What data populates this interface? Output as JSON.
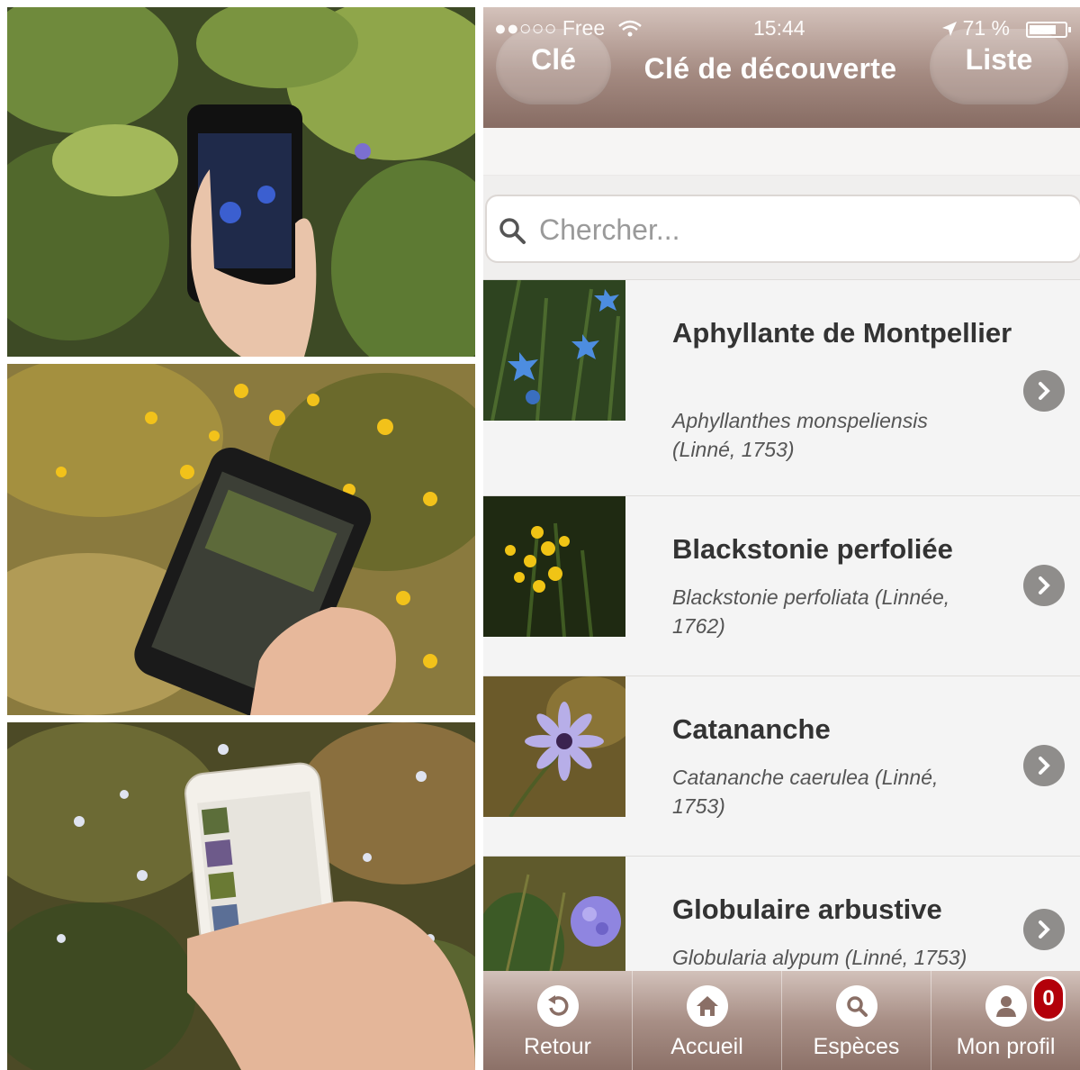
{
  "status_bar": {
    "carrier": "●●○○○ Free",
    "time": "15:44",
    "battery": "71 %"
  },
  "nav": {
    "left_button": "Clé",
    "title": "Clé de découverte",
    "right_button": "Liste"
  },
  "search": {
    "placeholder": "Chercher..."
  },
  "species": [
    {
      "name": "Aphyllante de Montpellier",
      "scientific": "Aphyllanthes monspeliensis (Linné, 1753)",
      "thumb": "blue star-shaped flowers"
    },
    {
      "name": "Blackstonie perfoliée",
      "scientific": "Blackstonie perfoliata (Linnée, 1762)",
      "thumb": "yellow flowers"
    },
    {
      "name": "Catananche",
      "scientific": "Catananche caerulea (Linné, 1753)",
      "thumb": "lilac flower"
    },
    {
      "name": "Globulaire arbustive",
      "scientific": "Globularia alypum (Linné, 1753)",
      "thumb": "purple globe flower"
    }
  ],
  "tabs": [
    {
      "label": "Retour",
      "icon": "back-arrow-icon"
    },
    {
      "label": "Accueil",
      "icon": "home-icon"
    },
    {
      "label": "Espèces",
      "icon": "search-icon"
    },
    {
      "label": "Mon profil",
      "icon": "user-icon",
      "badge": "0"
    }
  ],
  "colors": {
    "bar_top": "#d4c2bb",
    "bar_bottom": "#876c63",
    "badge": "#b3000a",
    "list_bg": "#f4f4f4"
  }
}
